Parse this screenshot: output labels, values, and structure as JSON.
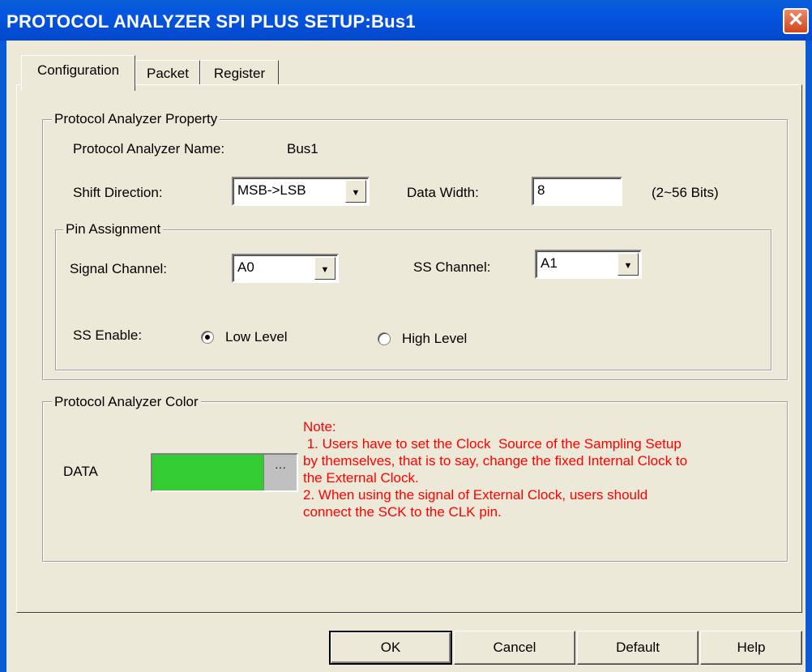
{
  "window": {
    "title": "PROTOCOL ANALYZER SPI PLUS SETUP:Bus1",
    "close_glyph": "✕"
  },
  "tabs": [
    {
      "label": "Configuration",
      "active": true
    },
    {
      "label": "Packet",
      "active": false
    },
    {
      "label": "Register",
      "active": false
    }
  ],
  "property": {
    "legend": "Protocol Analyzer Property",
    "name_label": "Protocol Analyzer Name:",
    "name_value": "Bus1",
    "shift_label": "Shift Direction:",
    "shift_value": "MSB->LSB",
    "width_label": "Data Width:",
    "width_value": "8",
    "width_hint": "(2~56 Bits)"
  },
  "pins": {
    "legend": "Pin Assignment",
    "signal_label": "Signal Channel:",
    "signal_value": "A0",
    "ss_label": "SS Channel:",
    "ss_value": "A1",
    "ss_enable_label": "SS Enable:",
    "radio_low": "Low Level",
    "radio_high": "High Level",
    "selected": "Low Level"
  },
  "color": {
    "legend": "Protocol Analyzer Color",
    "data_label": "DATA",
    "data_color": "#33cc33",
    "picker_label": "···",
    "note_lines": [
      "Note:",
      " 1. Users have to set the Clock  Source of the Sampling Setup",
      "by themselves, that is to say, change the fixed Internal Clock to",
      "the External Clock.",
      "2. When using the signal of External Clock, users should",
      "connect the SCK to the CLK pin."
    ]
  },
  "buttons": {
    "ok": "OK",
    "cancel": "Cancel",
    "default": "Default",
    "help": "Help"
  },
  "icons": {
    "dropdown": "chevron-down-icon",
    "close": "close-icon"
  },
  "colors": {
    "titlebar": "#0454e0",
    "note": "#ff0000",
    "face": "#ece9d8"
  }
}
